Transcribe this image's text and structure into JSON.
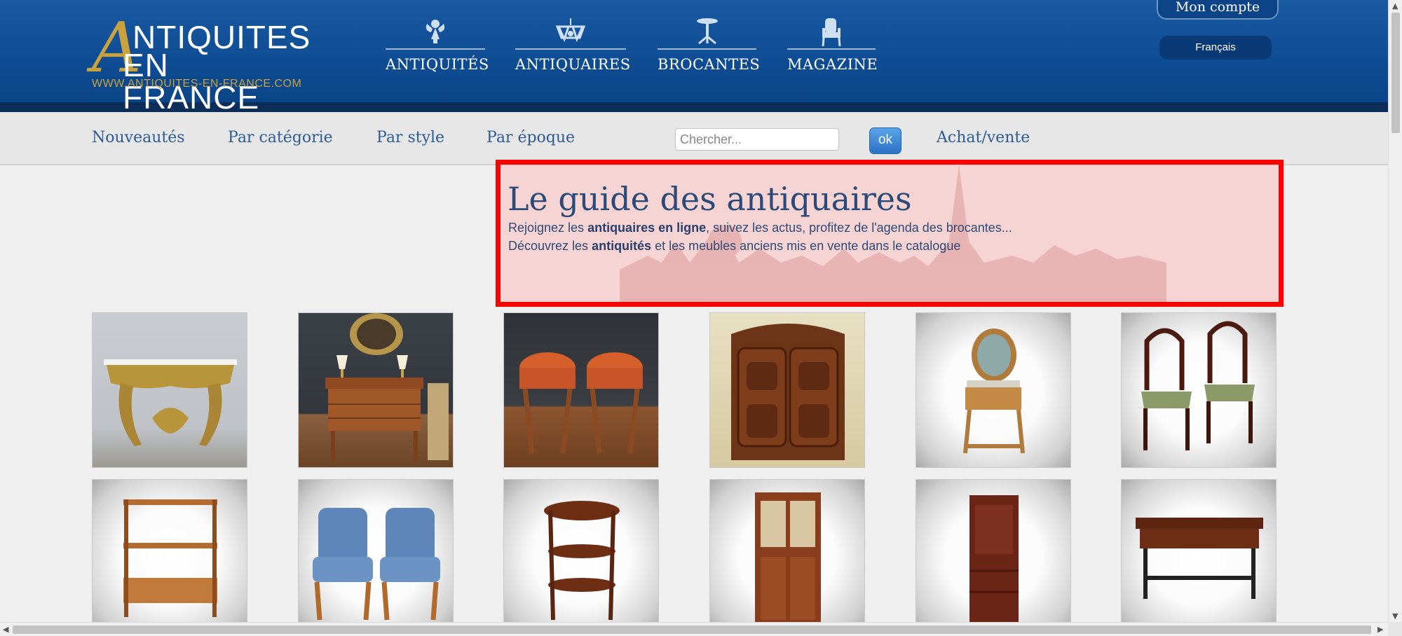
{
  "logo": {
    "letter": "A",
    "line1": "NTIQUITES",
    "line2": "EN FRANCE",
    "url": "WWW.ANTIQUITES-EN-FRANCE.COM"
  },
  "mainnav": [
    {
      "label": "ANTIQUITÉS",
      "icon": "cherub-icon"
    },
    {
      "label": "ANTIQUAIRES",
      "icon": "chandelier-icon"
    },
    {
      "label": "BROCANTES",
      "icon": "gueridon-table-icon"
    },
    {
      "label": "MAGAZINE",
      "icon": "armchair-icon"
    }
  ],
  "account": {
    "label": "Mon compte"
  },
  "language": {
    "selected": "Français"
  },
  "subnav": {
    "links": [
      "Nouveautés",
      "Par catégorie",
      "Par style",
      "Par époque"
    ],
    "search_placeholder": "Chercher...",
    "search_value": "",
    "search_button": "ok",
    "buy_sell": "Achat/vente"
  },
  "hero": {
    "title": "Le guide des antiquaires",
    "line1": {
      "pre": "Rejoignez les ",
      "bold": "antiquaires en ligne",
      "post": ", suivez les actus, profitez de l'agenda des brocantes..."
    },
    "line2": {
      "pre": "Découvrez les ",
      "bold": "antiquités",
      "post": " et les meubles anciens mis en vente dans le catalogue"
    }
  },
  "products": [
    {
      "subject": "gilded-console-table"
    },
    {
      "subject": "walnut-dresser-with-lamps"
    },
    {
      "subject": "pair-of-stools"
    },
    {
      "subject": "carved-armoire"
    },
    {
      "subject": "dressing-table-with-mirror"
    },
    {
      "subject": "pair-of-chairs"
    },
    {
      "subject": "shelf-etagere"
    },
    {
      "subject": "pair-of-blue-armchairs"
    },
    {
      "subject": "oval-side-table"
    },
    {
      "subject": "glazed-cabinet"
    },
    {
      "subject": "secretaire-cabinet"
    },
    {
      "subject": "carved-writing-table"
    }
  ],
  "colors": {
    "header_blue": "#0e4c93",
    "gold": "#c9a23e",
    "link_blue": "#2d5c95",
    "highlight_red": "#ff0000"
  }
}
